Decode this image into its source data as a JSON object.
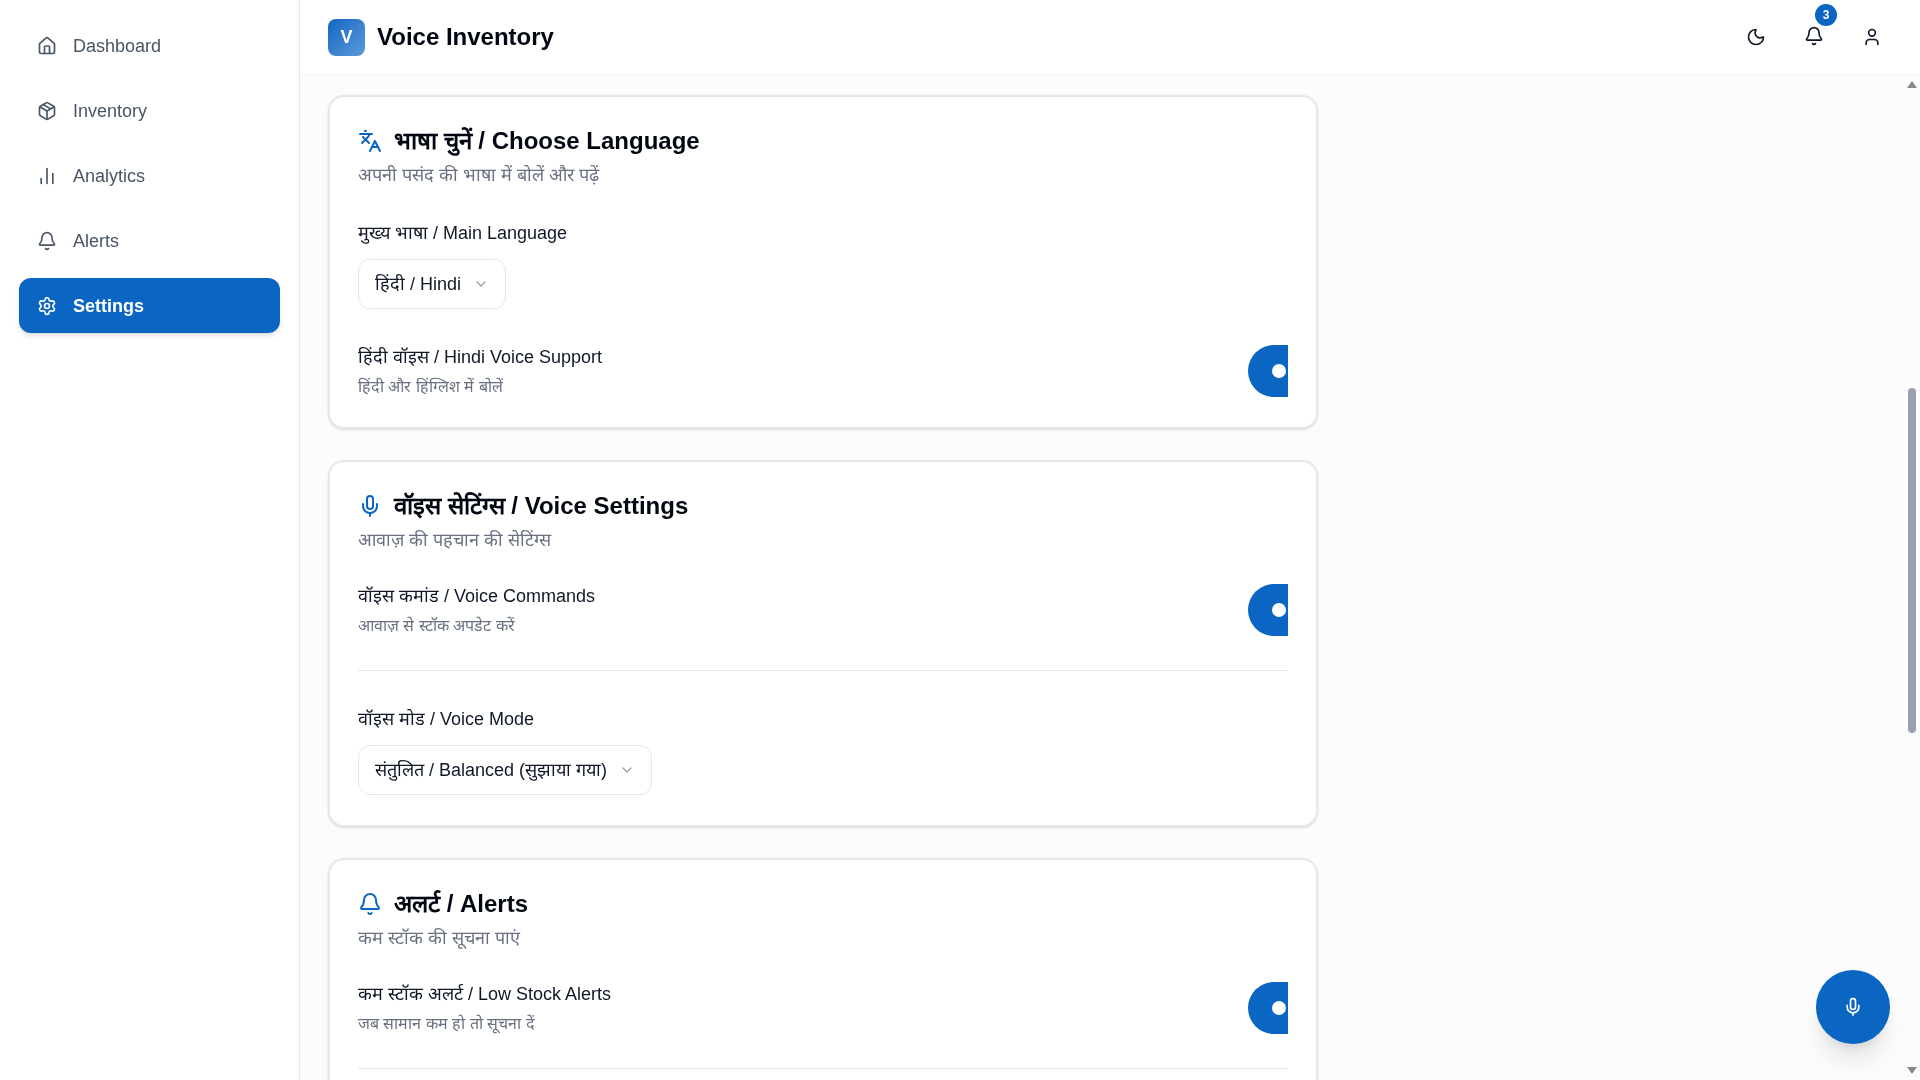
{
  "sidebar": {
    "items": [
      {
        "label": "Dashboard",
        "selected": false
      },
      {
        "label": "Inventory",
        "selected": false
      },
      {
        "label": "Analytics",
        "selected": false
      },
      {
        "label": "Alerts",
        "selected": false
      },
      {
        "label": "Settings",
        "selected": true
      }
    ]
  },
  "header": {
    "logo": "V",
    "title": "Voice Inventory",
    "notification_count": "3"
  },
  "sections": [
    {
      "title": "भाषा चुनें / Choose Language",
      "subtitle": "अपनी पसंद की भाषा में बोलें और पढ़ें",
      "rows": [
        {
          "kind": "select",
          "label": "मुख्य भाषा / Main Language",
          "value": "हिंदी / Hindi"
        },
        {
          "kind": "toggle",
          "label": "हिंदी वॉइस / Hindi Voice Support",
          "description": "हिंदी और हिंग्लिश में बोलें",
          "on": true
        }
      ]
    },
    {
      "title": "वॉइस सेटिंग्स / Voice Settings",
      "subtitle": "आवाज़ की पहचान की सेटिंग्स",
      "rows": [
        {
          "kind": "toggle",
          "label": "वॉइस कमांड / Voice Commands",
          "description": "आवाज़ से स्टॉक अपडेट करें",
          "on": true
        },
        {
          "kind": "select",
          "label": "वॉइस मोड / Voice Mode",
          "value": "संतुलित / Balanced (सुझाया गया)"
        }
      ]
    },
    {
      "title": "अलर्ट / Alerts",
      "subtitle": "कम स्टॉक की सूचना पाएं",
      "rows": [
        {
          "kind": "toggle",
          "label": "कम स्टॉक अलर्ट / Low Stock Alerts",
          "description": "जब सामान कम हो तो सूचना दें",
          "on": true,
          "divider_after": true
        }
      ]
    }
  ]
}
